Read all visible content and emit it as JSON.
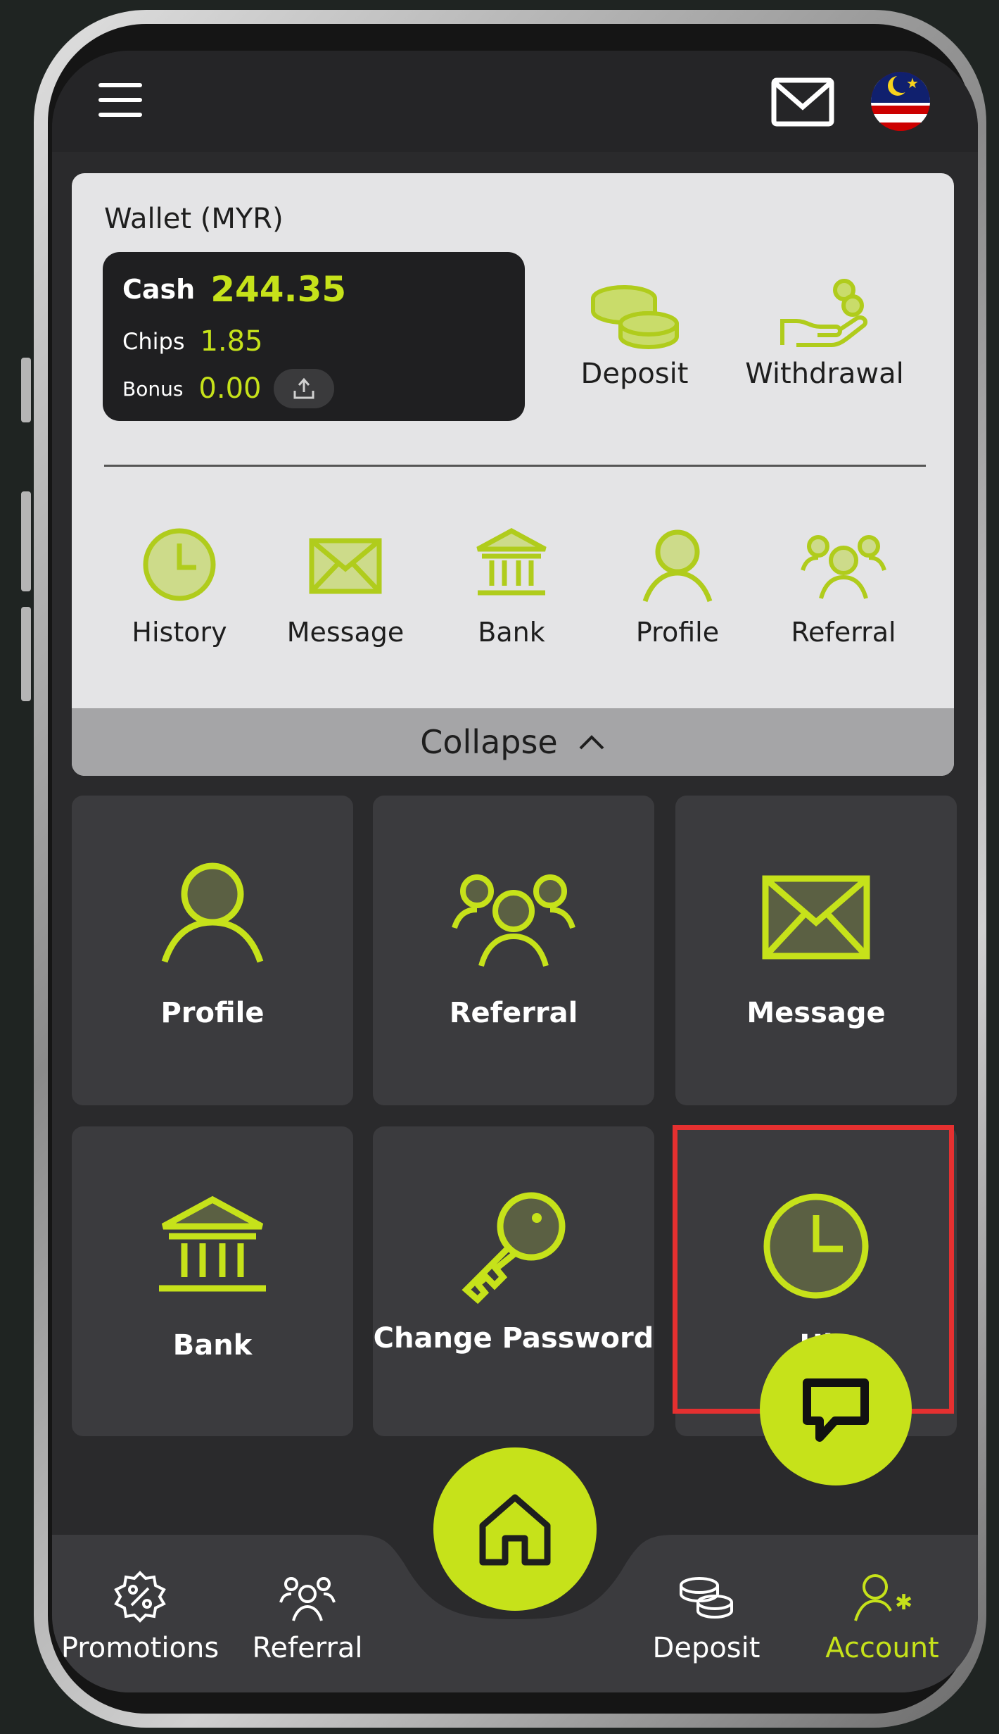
{
  "colors": {
    "accent": "#c6e21a",
    "highlight": "#e53030",
    "tile_bg": "#3b3b3e",
    "panel_bg": "#e4e4e6"
  },
  "topbar": {
    "menu_icon": "hamburger-icon",
    "mail_icon": "mail-icon",
    "language_flag": "malaysia-flag"
  },
  "wallet": {
    "title": "Wallet (MYR)",
    "cash_label": "Cash",
    "cash_value": "244.35",
    "chips_label": "Chips",
    "chips_value": "1.85",
    "bonus_label": "Bonus",
    "bonus_value": "0.00",
    "deposit_label": "Deposit",
    "withdrawal_label": "Withdrawal"
  },
  "quick_links": [
    {
      "label": "History",
      "icon": "clock-icon"
    },
    {
      "label": "Message",
      "icon": "envelope-icon"
    },
    {
      "label": "Bank",
      "icon": "bank-icon"
    },
    {
      "label": "Profile",
      "icon": "user-icon"
    },
    {
      "label": "Referral",
      "icon": "group-icon"
    }
  ],
  "collapse_label": "Collapse",
  "tiles": [
    {
      "label": "Profile",
      "icon": "user-icon"
    },
    {
      "label": "Referral",
      "icon": "group-icon"
    },
    {
      "label": "Message",
      "icon": "envelope-icon"
    },
    {
      "label": "Bank",
      "icon": "bank-icon"
    },
    {
      "label": "Change Password",
      "icon": "key-icon"
    },
    {
      "label": "Hi",
      "icon": "clock-icon"
    }
  ],
  "bottom_nav": [
    {
      "label": "Promotions",
      "icon": "percent-badge-icon"
    },
    {
      "label": "Referral",
      "icon": "group-icon"
    },
    {
      "label": "Deposit",
      "icon": "coins-icon"
    },
    {
      "label": "Account",
      "icon": "account-settings-icon",
      "active": true
    }
  ]
}
